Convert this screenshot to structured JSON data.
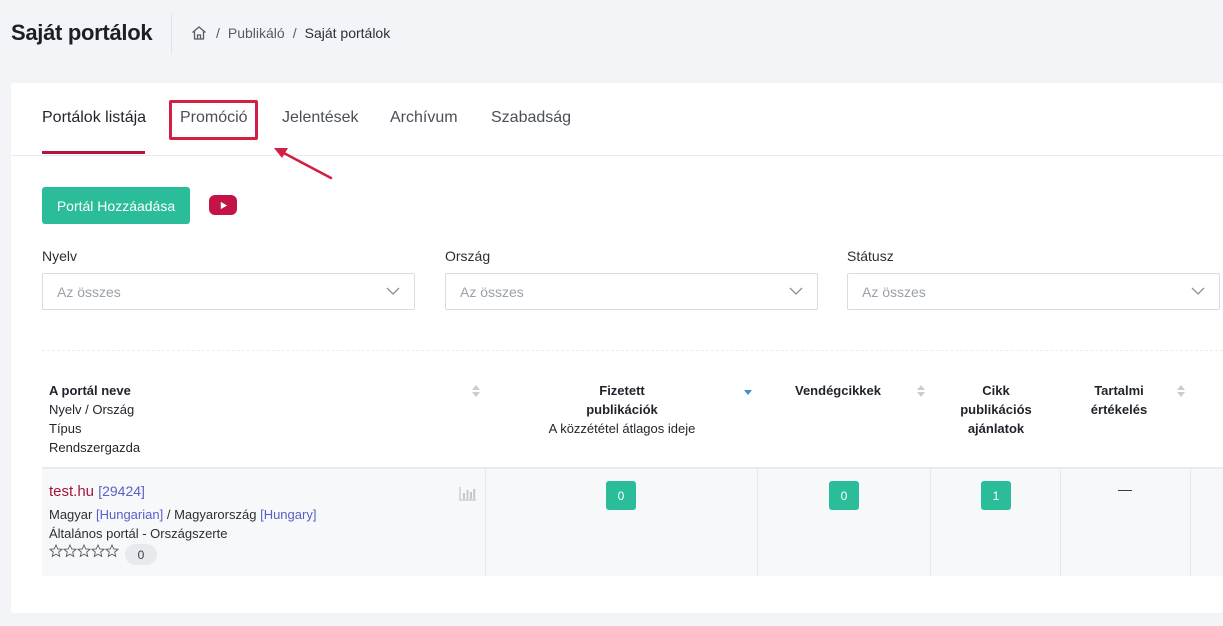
{
  "header": {
    "title": "Saját portálok",
    "breadcrumb": [
      "Publikáló",
      "Saját portálok"
    ]
  },
  "tabs": [
    {
      "label": "Portálok listája",
      "active": true
    },
    {
      "label": "Promóció",
      "highlighted": true
    },
    {
      "label": "Jelentések"
    },
    {
      "label": "Archívum"
    },
    {
      "label": "Szabadság"
    }
  ],
  "actions": {
    "add_portal_label": "Portál Hozzáadása"
  },
  "filters": [
    {
      "label": "Nyelv",
      "placeholder": "Az összes"
    },
    {
      "label": "Ország",
      "placeholder": "Az összes"
    },
    {
      "label": "Státusz",
      "placeholder": "Az összes"
    }
  ],
  "table": {
    "columns": {
      "portal": [
        "A portál neve",
        "Nyelv / Ország",
        "Típus",
        "Rendszergazda"
      ],
      "paid": [
        "Fizetett",
        "publikációk",
        "A közzététel átlagos ideje"
      ],
      "guest": [
        "Vendégcikkek"
      ],
      "offers": [
        "Cikk",
        "publikációs",
        "ajánlatok"
      ],
      "rating": [
        "Tartalmi",
        "értékelés"
      ]
    },
    "rows": [
      {
        "name": "test.hu",
        "id": "[29424]",
        "language": "Magyar",
        "language_en": "[Hungarian]",
        "sep": "/",
        "country": "Magyarország",
        "country_en": "[Hungary]",
        "type": "Általános portál - Országszerte",
        "rating": "0",
        "paid_count": "0",
        "guest_count": "0",
        "offers_count": "1",
        "content_rating": "—"
      }
    ]
  },
  "colors": {
    "accent": "#2bbd99",
    "brand": "#b3153c",
    "highlight": "#d31e45",
    "link": "#5a5fc7"
  }
}
